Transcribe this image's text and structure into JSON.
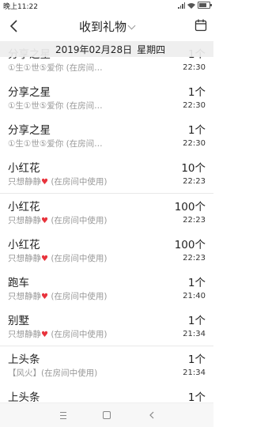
{
  "status_bar": {
    "time": "晚上11:22"
  },
  "header": {
    "title": "收到礼物"
  },
  "date_banner": {
    "date": "2019年02月28日",
    "weekday": "星期四"
  },
  "gifts": [
    {
      "name": "分享之星",
      "desc": "①生①世⑤爱你 (在房间…",
      "count": "1个",
      "time": "22:30"
    },
    {
      "name": "分享之星",
      "desc": "①生①世⑤爱你 (在房间…",
      "count": "1个",
      "time": "22:30"
    },
    {
      "name": "分享之星",
      "desc": "①生①世⑤爱你 (在房间…",
      "count": "1个",
      "time": "22:30"
    },
    {
      "name": "小红花",
      "desc": "只想静静",
      "desc_suffix": "(在房间中使用)",
      "count": "10个",
      "time": "22:23"
    },
    {
      "name": "小红花",
      "desc": "只想静静",
      "desc_suffix": "(在房间中使用)",
      "count": "100个",
      "time": "22:23"
    },
    {
      "name": "小红花",
      "desc": "只想静静",
      "desc_suffix": "(在房间中使用)",
      "count": "100个",
      "time": "22:23"
    },
    {
      "name": "跑车",
      "desc": "只想静静",
      "desc_suffix": "(在房间中使用)",
      "count": "1个",
      "time": "21:40"
    },
    {
      "name": "别墅",
      "desc": "只想静静",
      "desc_suffix": "(在房间中使用)",
      "count": "1个",
      "time": "21:34"
    },
    {
      "name": "上头条",
      "desc": "【风火】(在房间中使用)",
      "count": "1个",
      "time": "21:34"
    },
    {
      "name": "上头条",
      "desc": "",
      "count": "1个",
      "time": ""
    }
  ]
}
